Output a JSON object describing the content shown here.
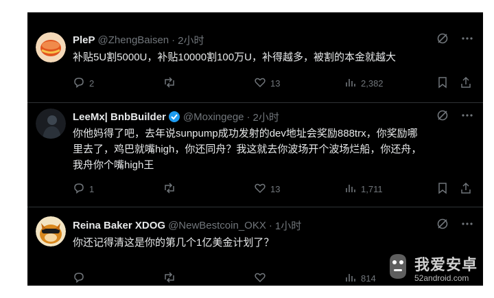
{
  "tweets": [
    {
      "name": "PleP",
      "handle": "@ZhengBaisen",
      "time": "2小时",
      "content": "补贴5U割5000U，补贴10000割100万U，补得越多，被割的本金就越大",
      "replies": "2",
      "reposts": "",
      "likes": "13",
      "views": "2,382"
    },
    {
      "name": "LeeMx| BnbBuilder",
      "handle": "@Moxingege",
      "time": "2小时",
      "content_lines": [
        "你他妈得了吧，去年说sunpump成功发射的dev地址会奖励888trx，你奖励哪",
        "里去了，鸡巴就嘴high，你还同舟？我这就去你波场开个波场烂船，你还舟，",
        "我舟你个嘴high王"
      ],
      "replies": "1",
      "reposts": "",
      "likes": "13",
      "views": "1,711"
    },
    {
      "name": "Reina Baker XDOG",
      "handle": "@NewBestcoin_OKX",
      "time": "1小时",
      "content": "你还记得清这是你的第几个1亿美金计划了？",
      "replies": "",
      "reposts": "",
      "likes": "",
      "views": "814"
    }
  ],
  "dot": "·",
  "icons": [
    "grok-icon",
    "more-icon",
    "reply-icon",
    "repost-icon",
    "like-icon",
    "views-icon",
    "bookmark-icon",
    "share-icon",
    "verified-icon"
  ],
  "colors": {
    "background": "#000000",
    "text": "#e7e9ea",
    "muted": "#71767b",
    "verified": "#1d9bf0",
    "separator": "#2f3336"
  },
  "watermark": {
    "text": "我爱安卓",
    "url": "52android.com"
  }
}
